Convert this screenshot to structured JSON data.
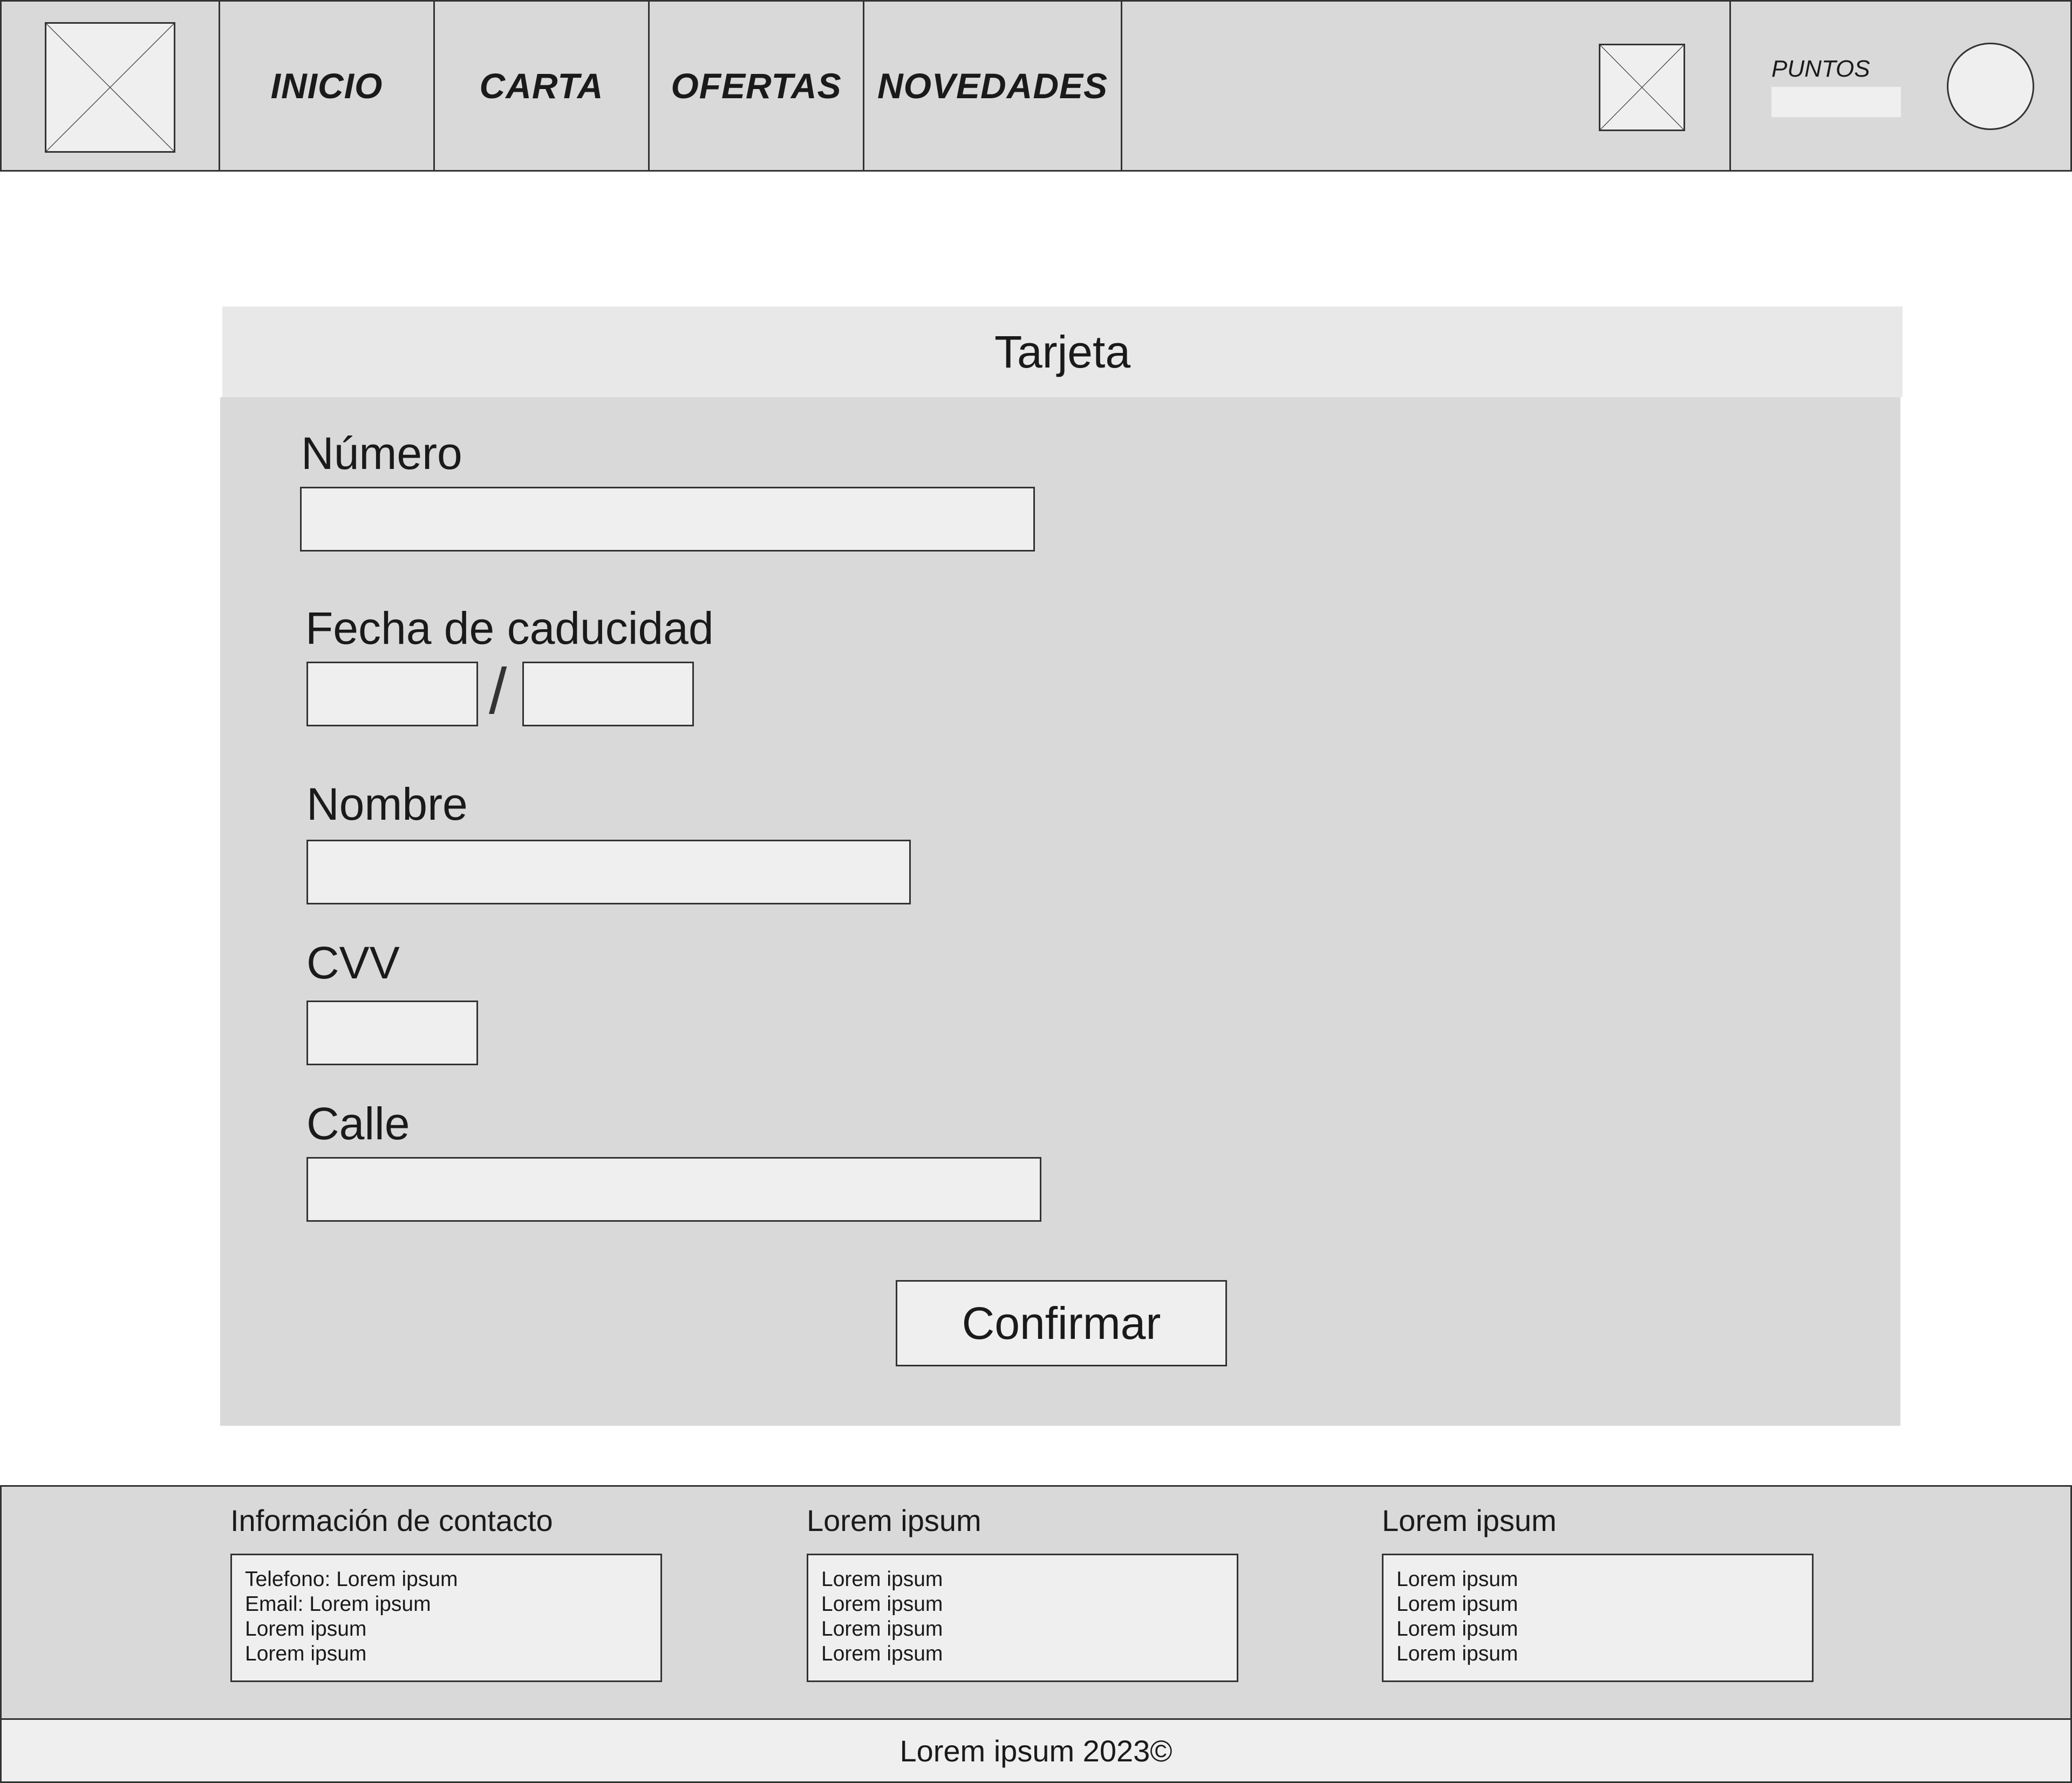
{
  "header": {
    "nav": [
      "INICIO",
      "CARTA",
      "OFERTAS",
      "NOVEDADES"
    ],
    "puntos_label": "PUNTOS"
  },
  "card": {
    "title": "Tarjeta",
    "numero_label": "Número",
    "fecha_label": "Fecha de caducidad",
    "fecha_separator": "/",
    "nombre_label": "Nombre",
    "cvv_label": "CVV",
    "calle_label": "Calle",
    "confirm_label": "Confirmar"
  },
  "footer": {
    "columns": [
      {
        "title": "Información de contacto",
        "lines": [
          "Telefono: Lorem ipsum",
          "Email: Lorem ipsum",
          "Lorem ipsum",
          "Lorem ipsum"
        ]
      },
      {
        "title": "Lorem ipsum",
        "lines": [
          "Lorem ipsum",
          "Lorem ipsum",
          "Lorem ipsum",
          "Lorem ipsum"
        ]
      },
      {
        "title": "Lorem ipsum",
        "lines": [
          "Lorem ipsum",
          "Lorem ipsum",
          "Lorem ipsum",
          "Lorem ipsum"
        ]
      }
    ],
    "copyright": "Lorem ipsum 2023©"
  },
  "icons": {
    "logo": "image-placeholder-icon",
    "cart": "image-placeholder-icon",
    "avatar": "user-avatar-icon"
  }
}
